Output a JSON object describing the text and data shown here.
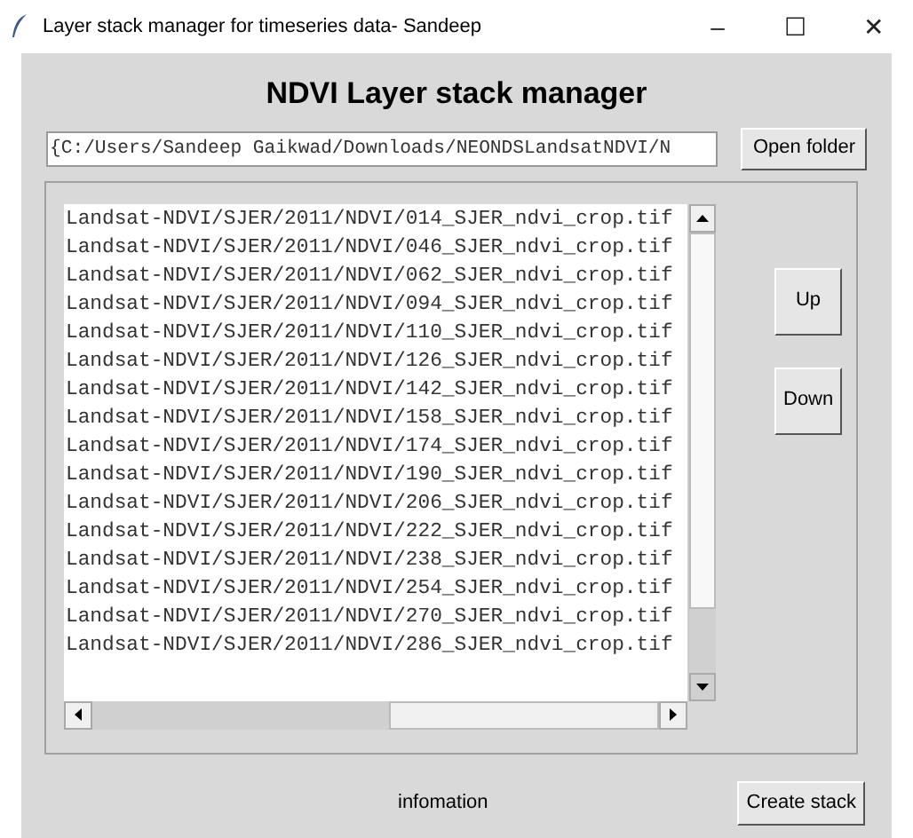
{
  "window": {
    "title": "Layer stack manager for timeseries data- Sandeep",
    "controls": [
      "–",
      "☐",
      "✕"
    ]
  },
  "heading": "NDVI Layer stack manager",
  "path_field": {
    "value": "{C:/Users/Sandeep Gaikwad/Downloads/NEONDSLandsatNDVI/N"
  },
  "open_button": "Open folder",
  "files": [
    "Landsat-NDVI/SJER/2011/NDVI/014_SJER_ndvi_crop.tif",
    "Landsat-NDVI/SJER/2011/NDVI/046_SJER_ndvi_crop.tif",
    "Landsat-NDVI/SJER/2011/NDVI/062_SJER_ndvi_crop.tif",
    "Landsat-NDVI/SJER/2011/NDVI/094_SJER_ndvi_crop.tif",
    "Landsat-NDVI/SJER/2011/NDVI/110_SJER_ndvi_crop.tif",
    "Landsat-NDVI/SJER/2011/NDVI/126_SJER_ndvi_crop.tif",
    "Landsat-NDVI/SJER/2011/NDVI/142_SJER_ndvi_crop.tif",
    "Landsat-NDVI/SJER/2011/NDVI/158_SJER_ndvi_crop.tif",
    "Landsat-NDVI/SJER/2011/NDVI/174_SJER_ndvi_crop.tif",
    "Landsat-NDVI/SJER/2011/NDVI/190_SJER_ndvi_crop.tif",
    "Landsat-NDVI/SJER/2011/NDVI/206_SJER_ndvi_crop.tif",
    "Landsat-NDVI/SJER/2011/NDVI/222_SJER_ndvi_crop.tif",
    "Landsat-NDVI/SJER/2011/NDVI/238_SJER_ndvi_crop.tif",
    "Landsat-NDVI/SJER/2011/NDVI/254_SJER_ndvi_crop.tif",
    "Landsat-NDVI/SJER/2011/NDVI/270_SJER_ndvi_crop.tif",
    "Landsat-NDVI/SJER/2011/NDVI/286_SJER_ndvi_crop.tif"
  ],
  "side_buttons": [
    "Up",
    "Down"
  ],
  "status": "infomation",
  "create_button": "Create stack"
}
